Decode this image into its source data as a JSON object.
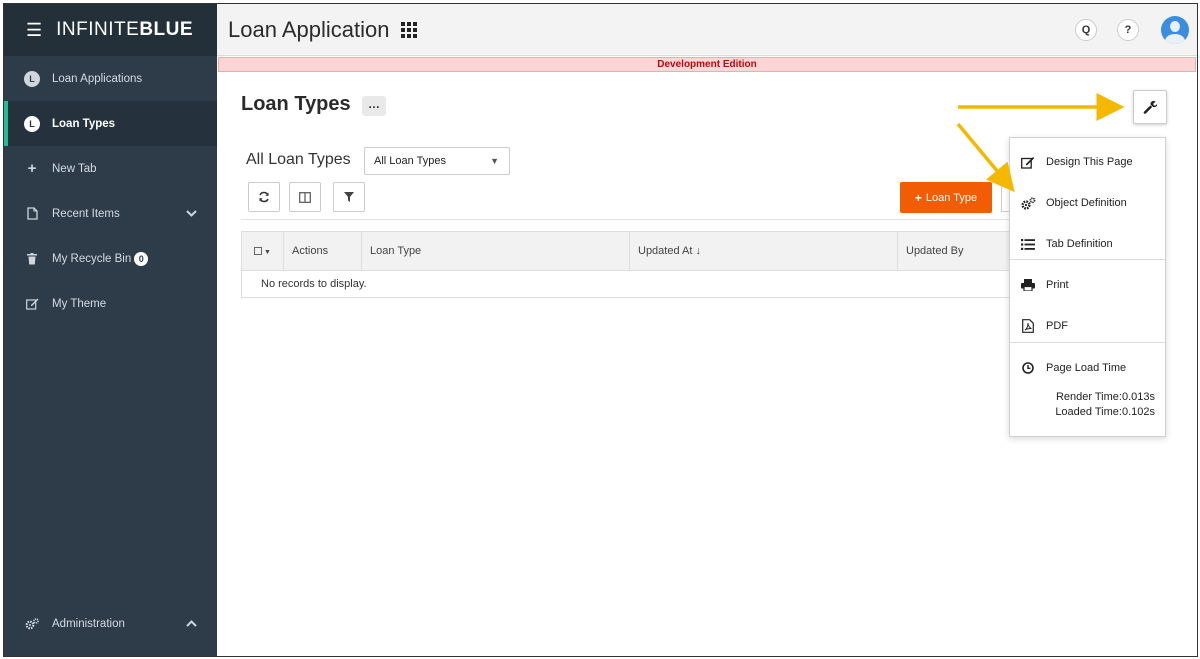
{
  "brand": {
    "prefix": "INFINITE",
    "suffix": "BLUE",
    "menu_icon": "hamburger-icon"
  },
  "sidebar": {
    "items": [
      {
        "label": "Loan Applications",
        "icon": "L",
        "active": false
      },
      {
        "label": "Loan Types",
        "icon": "L",
        "active": true
      },
      {
        "label": "New Tab",
        "icon": "plus-icon"
      },
      {
        "label": "Recent Items",
        "icon": "file-icon"
      },
      {
        "label": "My Recycle Bin",
        "icon": "trash-icon",
        "badge": "0"
      },
      {
        "label": "My Theme",
        "icon": "edit-icon"
      }
    ],
    "admin_label": "Administration"
  },
  "header": {
    "title": "Loan Application",
    "search_label": "Q",
    "help_label": "?"
  },
  "banner": {
    "text": "Development Edition"
  },
  "page": {
    "title": "Loan Types",
    "more_label": "…",
    "view_label": "All Loan Types",
    "view_select": "All Loan Types",
    "add_button": "Loan Type"
  },
  "grid": {
    "columns": [
      "Actions",
      "Loan Type",
      "Updated At ↓",
      "Updated By"
    ],
    "empty_message": "No records to display."
  },
  "dropdown": {
    "items": [
      {
        "label": "Design This Page",
        "icon": "edit-icon"
      },
      {
        "label": "Object Definition",
        "icon": "gears-icon"
      },
      {
        "label": "Tab Definition",
        "icon": "list-icon"
      },
      {
        "label": "Print",
        "icon": "print-icon"
      },
      {
        "label": "PDF",
        "icon": "pdf-icon"
      },
      {
        "label": "Page Load Time",
        "icon": "clock-icon"
      }
    ],
    "render_time": "Render Time:0.013s",
    "loaded_time": "Loaded Time:0.102s"
  },
  "colors": {
    "sidebar_bg": "#2e3b49",
    "active_accent": "#1fbf8f",
    "add_button": "#f25c05",
    "banner_text": "#b60d0d",
    "arrow": "#f5b800"
  }
}
